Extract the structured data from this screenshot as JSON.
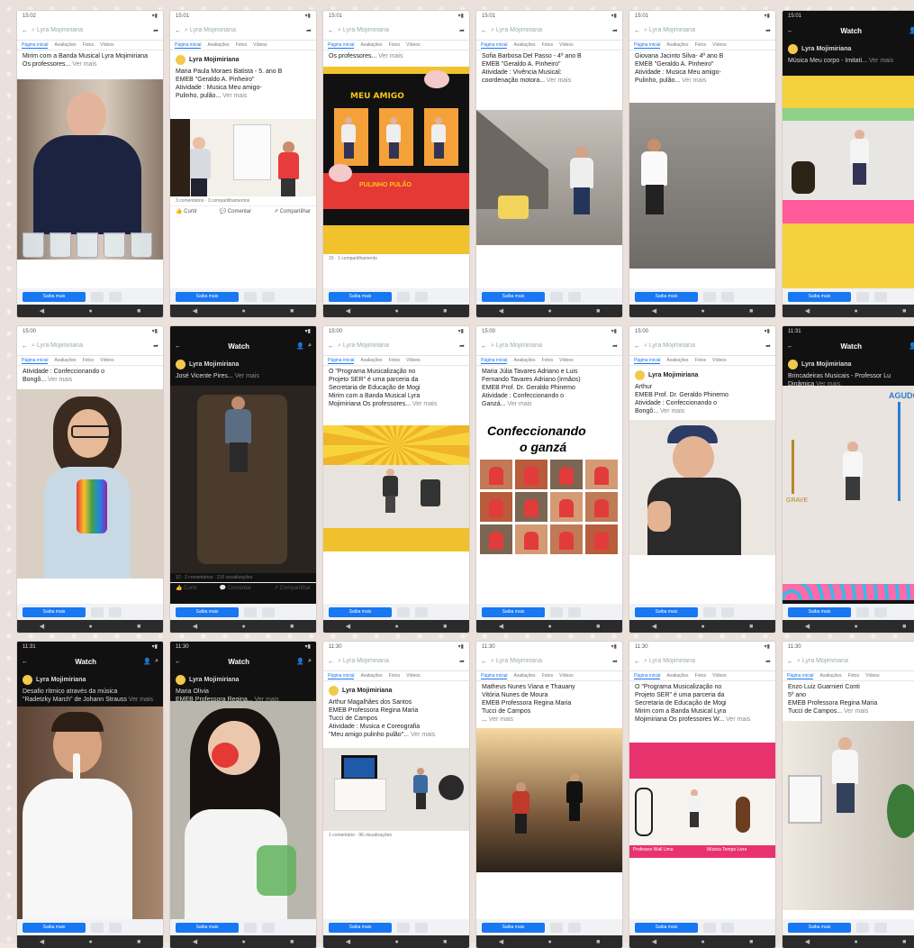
{
  "common": {
    "saiba_mais": "Saiba mais",
    "tabs": [
      "Página inicial",
      "Avaliações",
      "Fotos",
      "Vídeos"
    ],
    "page_name": "Lyra Mojimiriana",
    "watch": "Watch",
    "ver_mais": "Ver mais",
    "search": "Lyra Mojimiriana",
    "like": "Curtir",
    "comment": "Comentar",
    "share": "Compartilhar"
  },
  "phones": [
    {
      "time": "15:02",
      "dark": false,
      "text": "Mirim com a Banda Musical Lyra Mojimiriana\nOs professores...",
      "media": "teacher-cups"
    },
    {
      "time": "15:01",
      "dark": false,
      "text": "Maria Paula Moraes  Batista - 5. ano B\nEMEB \"Geraldo A. Pinheiro\"\nAtividade : Musica Meu amigo-\nPulinho, pulão...",
      "media": "kids-room",
      "stats": "3 comentários · 3 compartilhamentos",
      "showPage": true
    },
    {
      "time": "15:01",
      "dark": false,
      "text": "Os professores...",
      "media": "pulinho-pulao",
      "stats": "15 · 1 compartilhamento"
    },
    {
      "time": "15:01",
      "dark": false,
      "text": "Sofia Barbosa Del Passo - 4º ano B\nEMEB \"Geraldo A. Pinheiro\"\nAtividade : Vivência Musical:\ncoordenação motora...",
      "media": "girl-yard"
    },
    {
      "time": "15:01",
      "dark": false,
      "text": "Giovana Jacinto Silva- 4º ano B\nEMEB \"Geraldo A. Pinheiro\"\nAtividade : Musica Meu amigo-\nPulinho, pulão...",
      "media": "girl-wall"
    },
    {
      "time": "15:01",
      "dark": true,
      "text": "Música Meu corpo - Imitati...",
      "media": "teacher-room"
    },
    {
      "time": "15:00",
      "dark": false,
      "text": "Atividade : Confeccionando o\nBongô...",
      "media": "girl-shaker"
    },
    {
      "time": "",
      "dark": true,
      "text": "José Vicente Pires...",
      "media": "boy-chair",
      "stats": "12 · 2 comentários · 216 visualizações"
    },
    {
      "time": "15:00",
      "dark": false,
      "text": "O \"Programa Musicalização no\nProjeto SER\" é uma parceria da\nSecretaria de Educação de Mogi\nMirim com a Banda Musical Lyra\nMojimiriana Os professores...",
      "media": "teacher-drums"
    },
    {
      "time": "15:00",
      "dark": false,
      "text": "Maria Júlia Tavares Adriano e Luis\nFernando Tavares Adriano (irmãos)\nEMEB Prof. Dr. Geraldo Phinemo\nAtividade : Confeccionando o\nGanzá...",
      "media": "ganza"
    },
    {
      "time": "15:00",
      "dark": false,
      "text": "Arthur\nEMEB Prof. Dr. Geraldo Phinemo\nAtividade : Confeccionando o\nBongô...",
      "media": "boy-cap",
      "showPage": true
    },
    {
      "time": "11:31",
      "dark": true,
      "text": "Brincadeiras Musicais - Professor Lu\nDinâmica",
      "media": "agudo-grave"
    },
    {
      "time": "11:31",
      "dark": true,
      "text": "Desafio rítmico através da música\n\"Radetzky March\" de Johann Strauss",
      "media": "flute"
    },
    {
      "time": "11:30",
      "dark": true,
      "text": "Maria Olivia\nEMEB Professora Regina...",
      "media": "girl-mask"
    },
    {
      "time": "11:30",
      "dark": false,
      "text": "Arthur Magalhães dos Santos\nEMEB Professora Regina Maria\nTucci de Campos\nAtividade : Musica e Coreografia\n\"Meu amigo pulinho pulão\"...",
      "media": "room-tv",
      "stats": "1 comentário · 96 visualizações",
      "showPage": true
    },
    {
      "time": "11:30",
      "dark": false,
      "text": "Matheus Nunes Viana e Thauany\nVitória Nunes de Moura\nEMEB Professora Regina Maria\nTucci de Campos\n...",
      "media": "street"
    },
    {
      "time": "11:30",
      "dark": false,
      "text": "O \"Programa Musicalização no\nProjeto SER\" é uma parceria da\nSecretaria de Educação de Mogi\nMirim com a Banda Musical Lyra\nMojimiriana Os professores W...",
      "media": "guitars"
    },
    {
      "time": "11:30",
      "dark": false,
      "text": "Enzo Luiz Guarnieri Conti\n5º ano\nEMEB Professora Regina Maria\nTucci de Campos...",
      "media": "boy-window"
    }
  ],
  "media_text": {
    "meu_amigo": "MEU AMIGO",
    "pulinho": "PULINHO PULÃO",
    "confeccionando": "Confeccionando",
    "o_ganza": "o ganzá",
    "agudo": "AGUDO",
    "grave": "GRAVE",
    "banner1": "Professor Wall Lima",
    "banner2": "Música Tempo Livre"
  }
}
